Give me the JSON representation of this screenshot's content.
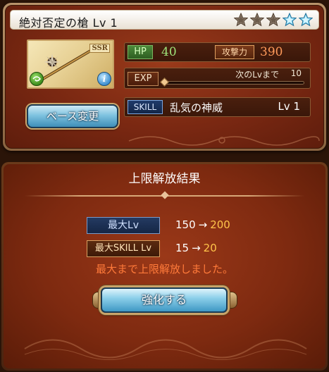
{
  "weapon": {
    "title": "絶対否定の槍 Lv 1",
    "rarity_badge": "SSR",
    "stars_filled": 3,
    "stars_total": 5,
    "info_glyph": "i"
  },
  "stats": {
    "hp_label": "HP",
    "hp_value": "40",
    "atk_label": "攻撃力",
    "atk_value": "390",
    "exp_label": "EXP",
    "exp_next_label": "次のLvまで",
    "exp_next_value": "10",
    "exp_progress": 0,
    "skill_label": "SKILL",
    "skill_name": "乱気の神威",
    "skill_level": "Lv 1"
  },
  "buttons": {
    "base_change": "ベース変更",
    "enhance": "強化する"
  },
  "result": {
    "header": "上限解放結果",
    "max_lv_label": "最大Lv",
    "max_lv_from": "150",
    "max_lv_to": "200",
    "max_skill_lv_label": "最大SKILL Lv",
    "max_skill_lv_from": "15",
    "max_skill_lv_to": "20",
    "arrow": "→",
    "notice": "最大まで上限解放しました。"
  },
  "colors": {
    "panel_red": "#7e2a10",
    "hp_green": "#9fe37a",
    "atk_orange": "#ff9a5a",
    "notice_orange": "#ff7a3a",
    "new_value_gold": "#ffc44a",
    "button_blue": "#8dd0ea"
  }
}
